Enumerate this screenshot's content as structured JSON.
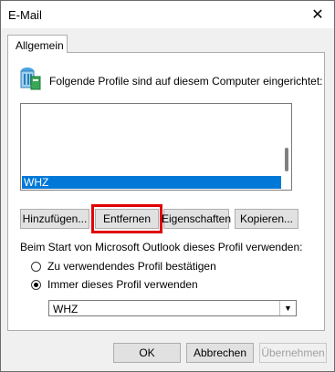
{
  "window": {
    "title": "E-Mail"
  },
  "tabs": [
    {
      "label": "Allgemein"
    }
  ],
  "header": {
    "text": "Folgende Profile sind auf diesem Computer eingerichtet:"
  },
  "profiles": {
    "items": [
      "WHZ"
    ],
    "selected": "WHZ"
  },
  "buttons": {
    "add": "Hinzufügen...",
    "remove": "Entfernen",
    "properties": "Eigenschaften",
    "copy": "Kopieren..."
  },
  "startup": {
    "label": "Beim Start von Microsoft Outlook dieses Profil verwenden:",
    "option_prompt": "Zu verwendendes Profil bestätigen",
    "option_always": "Immer dieses Profil verwenden",
    "selected_option": "always",
    "profile_select": {
      "value": "WHZ"
    }
  },
  "footer": {
    "ok": "OK",
    "cancel": "Abbrechen",
    "apply": "Übernehmen"
  },
  "colors": {
    "selection": "#0078d7",
    "highlight": "#e00000"
  }
}
